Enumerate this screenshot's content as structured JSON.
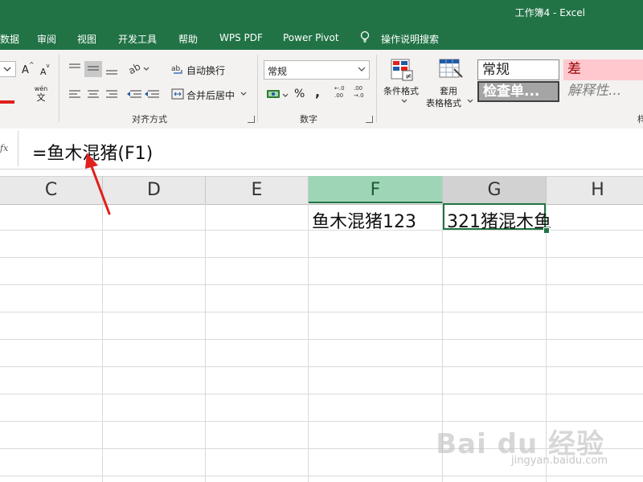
{
  "window": {
    "title": "工作簿4  -  Excel"
  },
  "tabs": [
    "数据",
    "审阅",
    "视图",
    "开发工具",
    "帮助",
    "WPS PDF",
    "Power Pivot",
    "操作说明搜索"
  ],
  "ribbon": {
    "font": {
      "grow_label": "A",
      "shrink_label": "A",
      "phonetic_top": "wén",
      "phonetic_bottom": "文"
    },
    "alignment": {
      "wrap_text": "自动换行",
      "merge_center": "合并后居中",
      "group_label": "对齐方式"
    },
    "number": {
      "format_value": "常规",
      "percent": "%",
      "comma": ",",
      "inc_decimal": "←.0\n.00",
      "dec_decimal": ".00\n→.0",
      "group_label": "数字"
    },
    "styles": {
      "conditional_label": "条件格式",
      "table_label_line1": "套用",
      "table_label_line2": "表格格式",
      "gallery": [
        "常规",
        "差",
        "检查单...",
        "解释性..."
      ],
      "group_label_partial": "样"
    }
  },
  "formula_bar": {
    "fx": "fx",
    "formula": "=鱼木混猪(F1)"
  },
  "columns": [
    "C",
    "D",
    "E",
    "F",
    "G",
    "H"
  ],
  "selected_column": "G",
  "cells": {
    "F1": "鱼木混猪123",
    "G1": "321猪混木鱼"
  },
  "watermark": {
    "logo": "Bai du 经验",
    "url": "jingyan.baidu.com"
  },
  "colors": {
    "excel_green": "#217346",
    "selected_header": "#9fd5b7",
    "arrow": "#e0201c"
  }
}
